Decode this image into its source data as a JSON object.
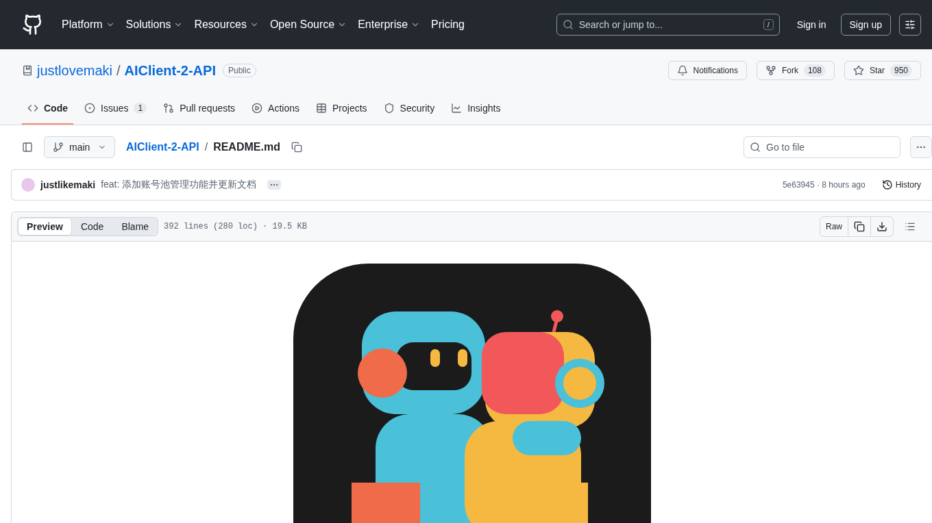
{
  "nav": {
    "items": [
      {
        "label": "Platform",
        "has_menu": true
      },
      {
        "label": "Solutions",
        "has_menu": true
      },
      {
        "label": "Resources",
        "has_menu": true
      },
      {
        "label": "Open Source",
        "has_menu": true
      },
      {
        "label": "Enterprise",
        "has_menu": true
      },
      {
        "label": "Pricing",
        "has_menu": false
      }
    ],
    "search": {
      "placeholder": "Search or jump to...",
      "shortcut": "/"
    },
    "sign_in": "Sign in",
    "sign_up": "Sign up"
  },
  "repo": {
    "owner": "justlovemaki",
    "separator": "/",
    "name": "AIClient-2-API",
    "visibility": "Public",
    "actions": [
      {
        "kind": "notifications",
        "label": "Notifications"
      },
      {
        "kind": "fork",
        "label": "Fork",
        "count": "108"
      },
      {
        "kind": "star",
        "label": "Star",
        "count": "950"
      }
    ]
  },
  "tabs": [
    {
      "kind": "code",
      "label": "Code",
      "selected": true
    },
    {
      "kind": "issues",
      "label": "Issues",
      "count": "1",
      "selected": false
    },
    {
      "kind": "pulls",
      "label": "Pull requests",
      "selected": false
    },
    {
      "kind": "actions",
      "label": "Actions",
      "selected": false
    },
    {
      "kind": "projects",
      "label": "Projects",
      "selected": false
    },
    {
      "kind": "security",
      "label": "Security",
      "selected": false
    },
    {
      "kind": "insights",
      "label": "Insights",
      "selected": false
    }
  ],
  "file_nav": {
    "branch": "main",
    "separator": "/",
    "path": [
      {
        "kind": "link",
        "label": "AIClient-2-API"
      },
      {
        "kind": "current",
        "label": "README.md"
      }
    ],
    "go_to_file": {
      "placeholder": "Go to file"
    }
  },
  "commit": {
    "author": "justlikemaki",
    "message": "feat: 添加账号池管理功能并更新文档",
    "sha_time": "5e63945 · 8 hours ago",
    "history": "History"
  },
  "file": {
    "views": [
      {
        "label": "Preview",
        "selected": true
      },
      {
        "label": "Code",
        "selected": false
      },
      {
        "label": "Blame",
        "selected": false
      }
    ],
    "info": "392 lines (280 loc) · 19.5 KB",
    "raw": "Raw"
  }
}
